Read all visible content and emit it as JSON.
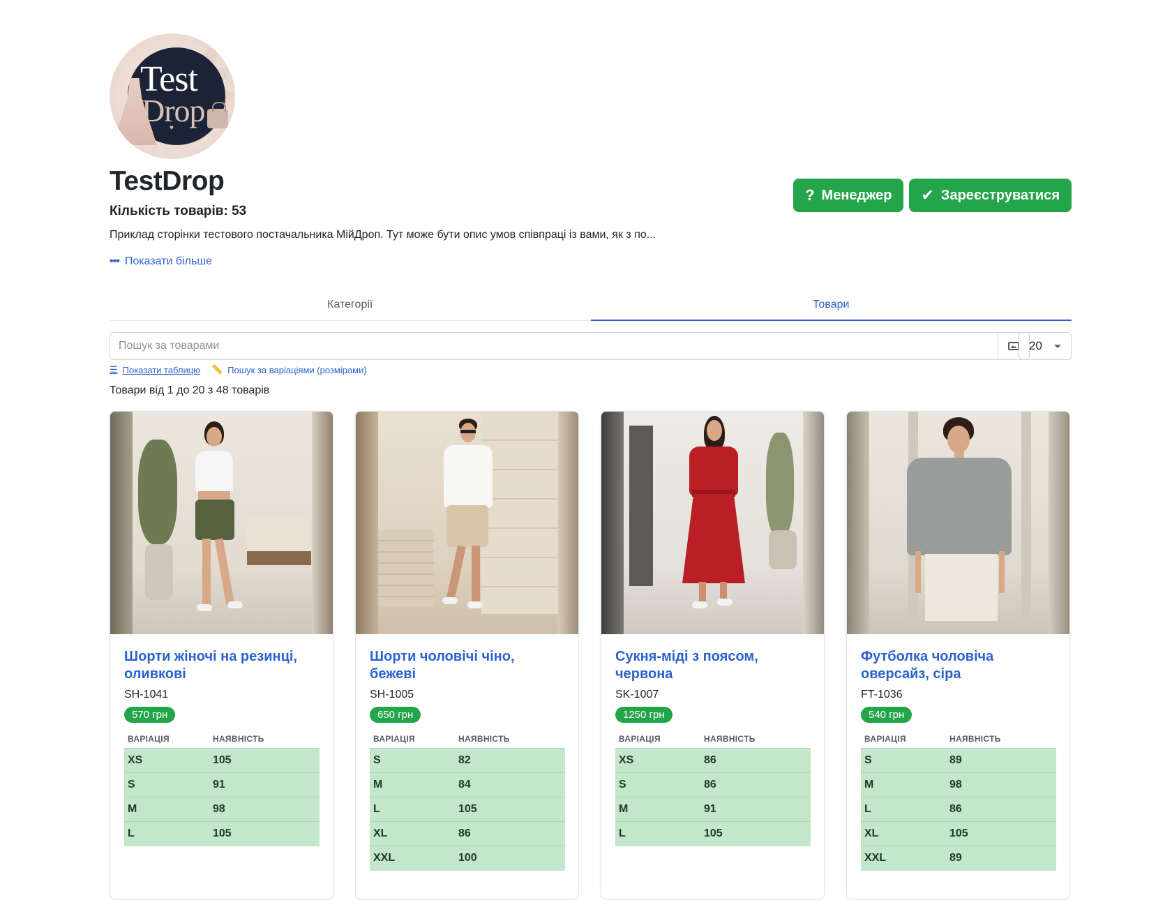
{
  "shop": {
    "name": "TestDrop",
    "logo_text_1": "Test",
    "logo_text_2": "Drop",
    "count_text": "Кількість товарів: 53",
    "description": "Приклад сторінки тестового постачальника МійДроп. Тут може бути опис умов співпраці із вами, як з по...",
    "show_more": "Показати більше"
  },
  "buttons": {
    "manager": "Менеджер",
    "register": "Зареєструватися"
  },
  "tabs": [
    {
      "label": "Категорії",
      "active": false
    },
    {
      "label": "Товари",
      "active": true
    }
  ],
  "search": {
    "placeholder": "Пошук за товарами",
    "per_page": "20"
  },
  "links": {
    "show_table": "Показати таблицю",
    "variation_search": "Пошук за варіаціями (розмірами)"
  },
  "summary": "Товари від 1 до 20 з 48 товарів",
  "table_headers": {
    "variation": "ВАРІАЦІЯ",
    "stock": "НАЯВНІСТЬ"
  },
  "colors": {
    "accent": "#2a62cf",
    "green": "#24a54a",
    "stock_row": "#c4e6cb"
  },
  "products": [
    {
      "title": "Шорти жіночі на резинці, оливкові",
      "sku": "SH-1041",
      "price": "570 грн",
      "variations": [
        [
          "XS",
          "105"
        ],
        [
          "S",
          "91"
        ],
        [
          "M",
          "98"
        ],
        [
          "L",
          "105"
        ]
      ]
    },
    {
      "title": "Шорти чоловічі чіно, бежеві",
      "sku": "SH-1005",
      "price": "650 грн",
      "variations": [
        [
          "S",
          "82"
        ],
        [
          "M",
          "84"
        ],
        [
          "L",
          "105"
        ],
        [
          "XL",
          "86"
        ],
        [
          "XXL",
          "100"
        ]
      ]
    },
    {
      "title": "Сукня-міді з поясом, червона",
      "sku": "SK-1007",
      "price": "1250 грн",
      "variations": [
        [
          "XS",
          "86"
        ],
        [
          "S",
          "86"
        ],
        [
          "M",
          "91"
        ],
        [
          "L",
          "105"
        ]
      ]
    },
    {
      "title": "Футболка чоловіча оверсайз, сіра",
      "sku": "FT-1036",
      "price": "540 грн",
      "variations": [
        [
          "S",
          "89"
        ],
        [
          "M",
          "98"
        ],
        [
          "L",
          "86"
        ],
        [
          "XL",
          "105"
        ],
        [
          "XXL",
          "89"
        ]
      ]
    }
  ]
}
